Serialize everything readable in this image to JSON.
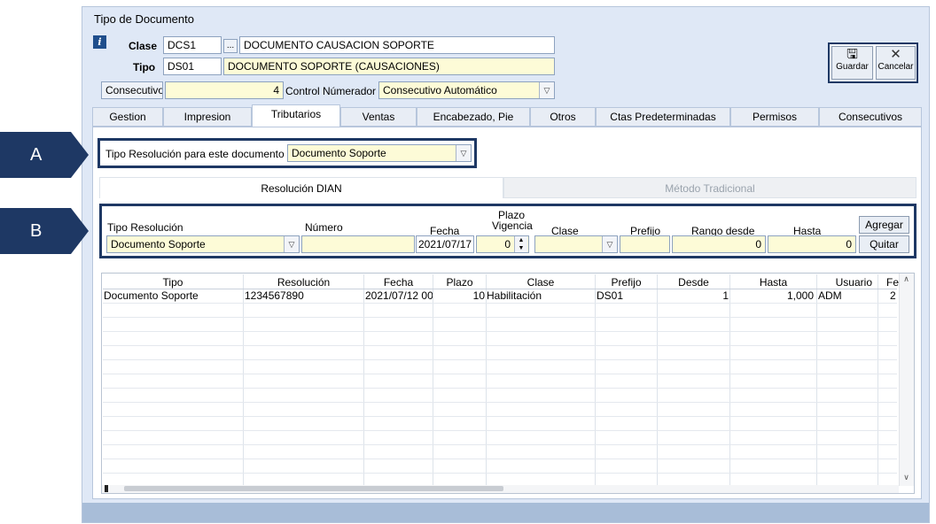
{
  "window": {
    "title": "Tipo de Documento"
  },
  "header": {
    "clase_label": "Clase",
    "clase_code": "DCS1",
    "clase_ellipsis": "...",
    "clase_desc": "DOCUMENTO CAUSACION SOPORTE",
    "tipo_label": "Tipo",
    "tipo_code": "DS01",
    "tipo_desc": "DOCUMENTO SOPORTE (CAUSACIONES)",
    "consecutivo_label": "Consecutivo",
    "consecutivo_value": "4",
    "control_label": "Control Númerador :",
    "control_value": "Consecutivo Automático"
  },
  "actions": {
    "save_label": "Guardar",
    "cancel_label": "Cancelar"
  },
  "tabs": [
    {
      "label": "Gestion"
    },
    {
      "label": "Impresion"
    },
    {
      "label": "Tributarios"
    },
    {
      "label": "Ventas"
    },
    {
      "label": "Encabezado, Pie"
    },
    {
      "label": "Otros"
    },
    {
      "label": "Ctas Predeterminadas"
    },
    {
      "label": "Permisos"
    },
    {
      "label": "Consecutivos"
    }
  ],
  "tributarios": {
    "tipo_resolucion_label": "Tipo Resolución para este documento  :",
    "tipo_resolucion_value": "Documento Soporte",
    "subtabs": [
      {
        "label": "Resolución DIAN"
      },
      {
        "label": "Método Tradicional"
      }
    ],
    "form": {
      "tipo_label": "Tipo Resolución",
      "tipo_value": "Documento Soporte",
      "numero_label": "Número",
      "numero_value": "",
      "fecha_label": "Fecha",
      "fecha_value": "2021/07/17",
      "plazo_label_1": "Plazo",
      "plazo_label_2": "Vigencia",
      "plazo_value": "0",
      "clase_label": "Clase",
      "clase_value": "",
      "prefijo_label": "Prefijo",
      "prefijo_value": "",
      "desde_label": "Rango desde",
      "desde_value": "0",
      "hasta_label": "Hasta",
      "hasta_value": "0",
      "agregar_label": "Agregar",
      "quitar_label": "Quitar"
    },
    "grid": {
      "columns": [
        "Tipo",
        "Resolución",
        "Fecha",
        "Plazo",
        "Clase",
        "Prefijo",
        "Desde",
        "Hasta",
        "Usuario",
        "Fe"
      ],
      "rows": [
        [
          "Documento Soporte",
          "1234567890",
          "2021/07/12 00",
          "10",
          "Habilitación",
          "DS01",
          "1",
          "1,000",
          "ADM",
          "2"
        ]
      ]
    }
  },
  "annotations": {
    "a_label": "A",
    "b_label": "B"
  },
  "colors": {
    "navy": "#1e3864",
    "window_bg": "#dfe8f6",
    "field_yellow": "#fdfbd7"
  }
}
